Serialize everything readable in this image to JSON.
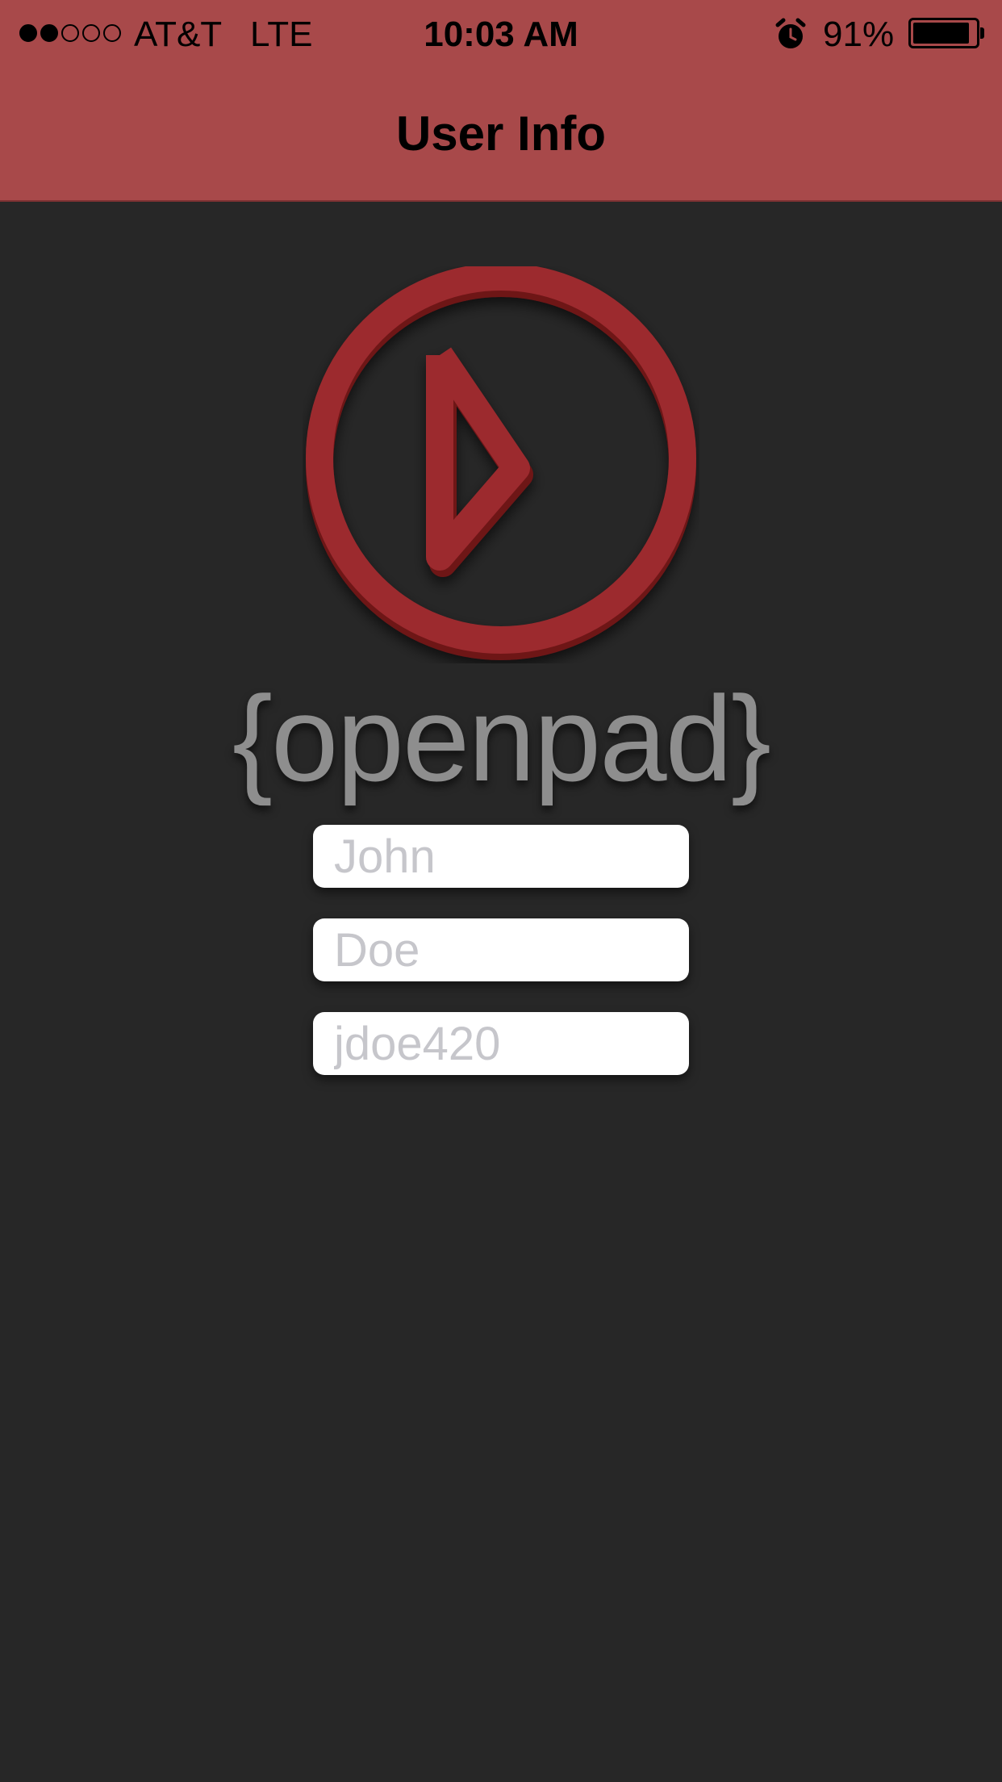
{
  "status_bar": {
    "signal_filled": 2,
    "signal_total": 5,
    "carrier": "AT&T",
    "network": "LTE",
    "time": "10:03 AM",
    "alarm_icon": "alarm-clock-icon",
    "battery_percent": "91%",
    "battery_level": 0.91
  },
  "nav": {
    "title": "User Info"
  },
  "colors": {
    "nav_bar": "#a8494a",
    "background": "#272727",
    "logo_red": "#9c2a2e",
    "wordmark_gray": "#8e8e8e"
  },
  "logo": {
    "icon": "play-circle-icon",
    "wordmark": "{openpad}"
  },
  "form": {
    "first_name": {
      "value": "",
      "placeholder": "John"
    },
    "last_name": {
      "value": "",
      "placeholder": "Doe"
    },
    "username": {
      "value": "",
      "placeholder": "jdoe420"
    }
  }
}
